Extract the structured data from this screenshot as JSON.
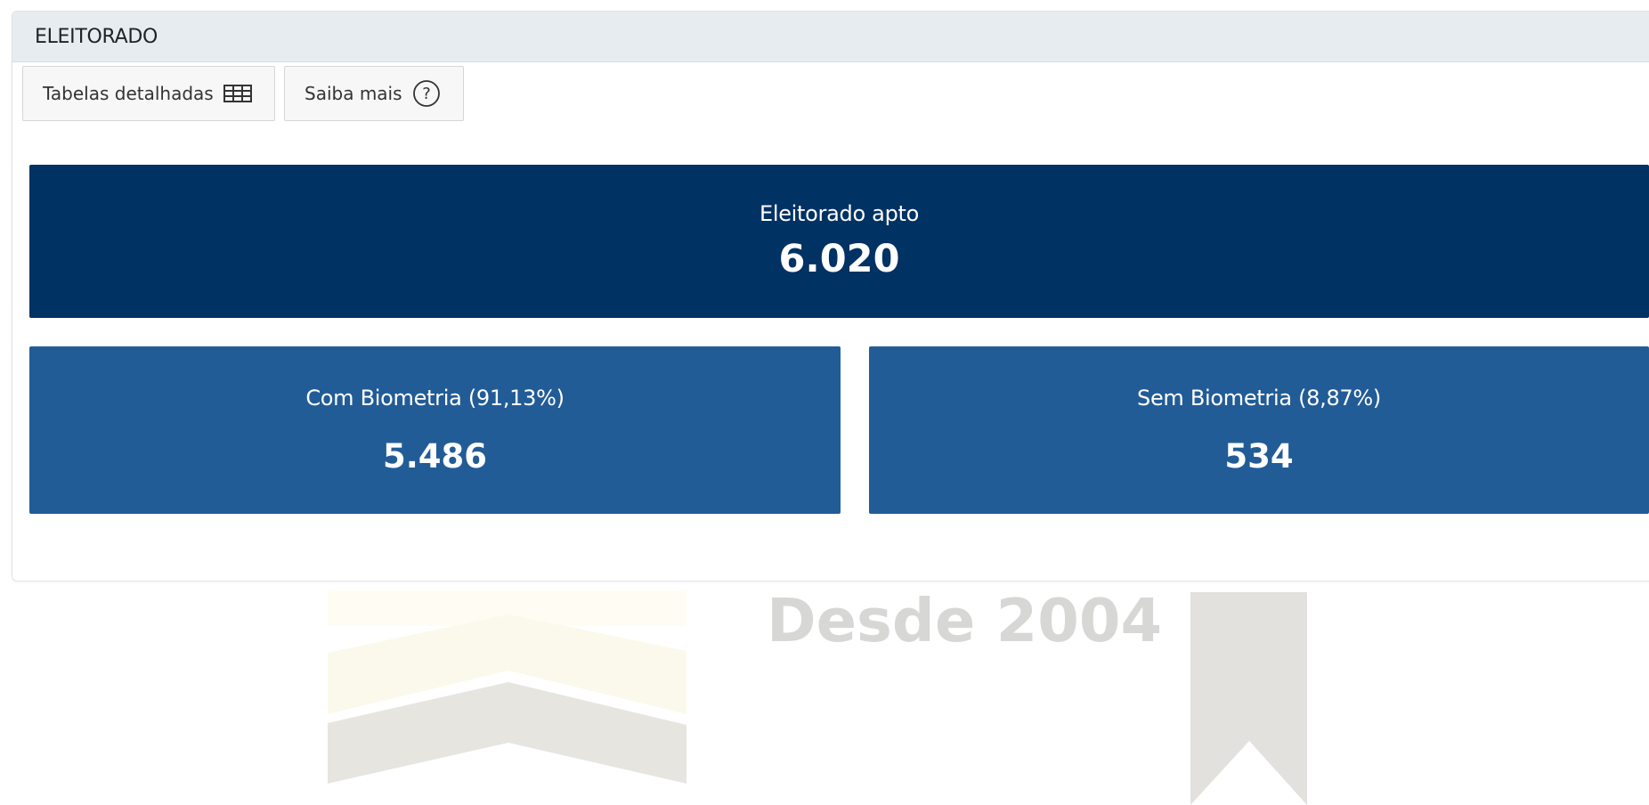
{
  "panel": {
    "title": "ELEITORADO"
  },
  "toolbar": {
    "tables_label": "Tabelas detalhadas",
    "info_label": "Saiba mais",
    "tables_icon": "table-icon",
    "info_icon": "question-circle-icon"
  },
  "summary": {
    "main_label": "Eleitorado apto",
    "main_value": "6.020",
    "with_bio_label": "Com Biometria (91,13%)",
    "with_bio_value": "5.486",
    "without_bio_label": "Sem Biometria (8,87%)",
    "without_bio_value": "534"
  },
  "watermark": {
    "text": "Desde 2004"
  },
  "colors": {
    "main_tile": "#003264",
    "sub_tile": "#225c97",
    "header_bg": "#e7ecf0"
  }
}
